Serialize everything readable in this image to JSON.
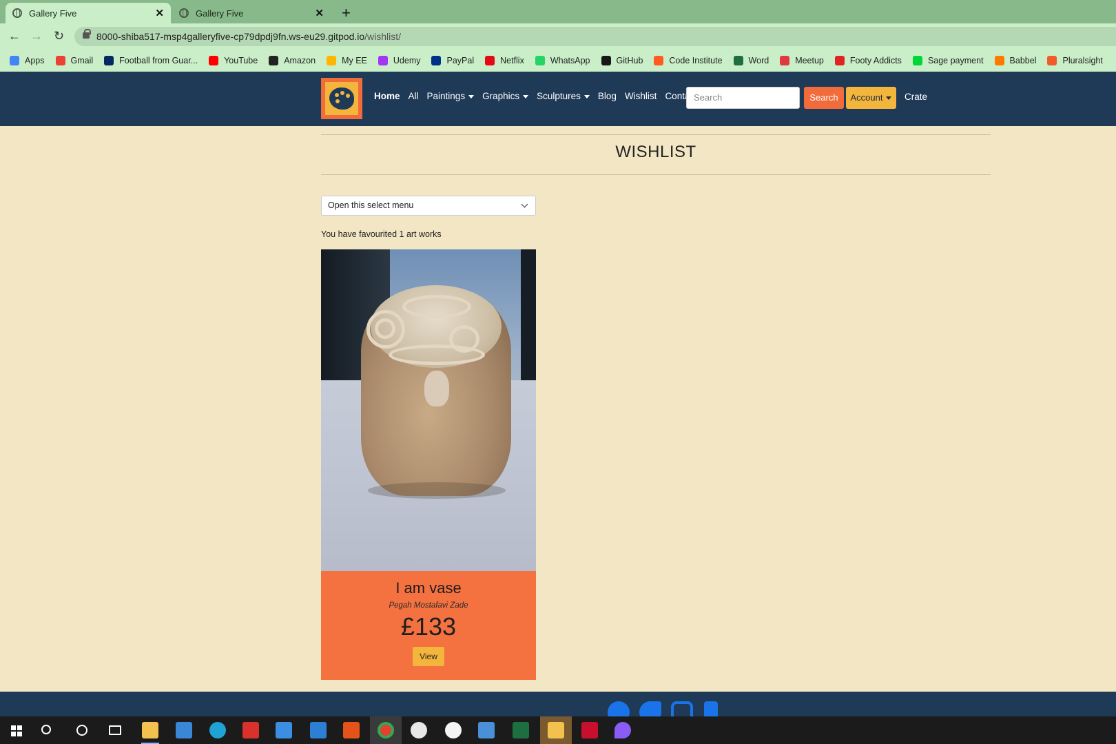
{
  "browser": {
    "tabs": [
      {
        "label": "Gallery Five",
        "active": true
      },
      {
        "label": "Gallery Five",
        "active": false
      }
    ],
    "url_host": "8000-shiba517-msp4galleryfive-cp79dpdj9fn.ws-eu29.gitpod.io",
    "url_path": "/wishlist/",
    "bookmarks": [
      {
        "label": "Apps",
        "icon": "apps-grid-icon",
        "color": "#4285f4"
      },
      {
        "label": "Gmail",
        "icon": "gmail-icon",
        "color": "#ea4335"
      },
      {
        "label": "Football from Guar...",
        "icon": "guardian-icon",
        "color": "#052962"
      },
      {
        "label": "YouTube",
        "icon": "youtube-icon",
        "color": "#ff0000"
      },
      {
        "label": "Amazon",
        "icon": "amazon-icon",
        "color": "#222222"
      },
      {
        "label": "My EE",
        "icon": "ee-icon",
        "color": "#ffb600"
      },
      {
        "label": "Udemy",
        "icon": "udemy-icon",
        "color": "#a435f0"
      },
      {
        "label": "PayPal",
        "icon": "paypal-icon",
        "color": "#003087"
      },
      {
        "label": "Netflix",
        "icon": "netflix-icon",
        "color": "#e50914"
      },
      {
        "label": "WhatsApp",
        "icon": "whatsapp-icon",
        "color": "#25d366"
      },
      {
        "label": "GitHub",
        "icon": "github-icon",
        "color": "#181717"
      },
      {
        "label": "Code Institute",
        "icon": "code-institute-icon",
        "color": "#ff5a1f"
      },
      {
        "label": "Word",
        "icon": "excel-word-icon",
        "color": "#1d6f42"
      },
      {
        "label": "Meetup",
        "icon": "meetup-icon",
        "color": "#e0393e"
      },
      {
        "label": "Footy Addicts",
        "icon": "footy-addicts-icon",
        "color": "#e02424"
      },
      {
        "label": "Sage payment",
        "icon": "sage-icon",
        "color": "#00d639"
      },
      {
        "label": "Babbel",
        "icon": "babbel-icon",
        "color": "#ff7900"
      },
      {
        "label": "Pluralsight",
        "icon": "pluralsight-icon",
        "color": "#f15b2a"
      }
    ]
  },
  "site": {
    "nav": {
      "home": "Home",
      "all": "All",
      "paintings": "Paintings",
      "graphics": "Graphics",
      "sculptures": "Sculptures",
      "blog": "Blog",
      "wishlist": "Wishlist",
      "contact": "Contact",
      "search_placeholder": "Search",
      "search_button": "Search",
      "account": "Account",
      "crate": "Crate"
    },
    "page_title": "WISHLIST",
    "select_label": "Open this select menu",
    "fav_count_text": "You have favourited 1 art works",
    "artwork": {
      "title": "I am vase",
      "artist": "Pegah Mostafavi Zade",
      "price": "£133",
      "view_label": "View"
    },
    "colors": {
      "navbar": "#1f3a57",
      "background": "#f3e6c4",
      "accent_orange": "#f47140",
      "accent_yellow": "#f3b53b"
    }
  },
  "footer": {
    "social": [
      "facebook-icon",
      "twitter-icon",
      "instagram-icon",
      "tiktok-icon"
    ]
  }
}
